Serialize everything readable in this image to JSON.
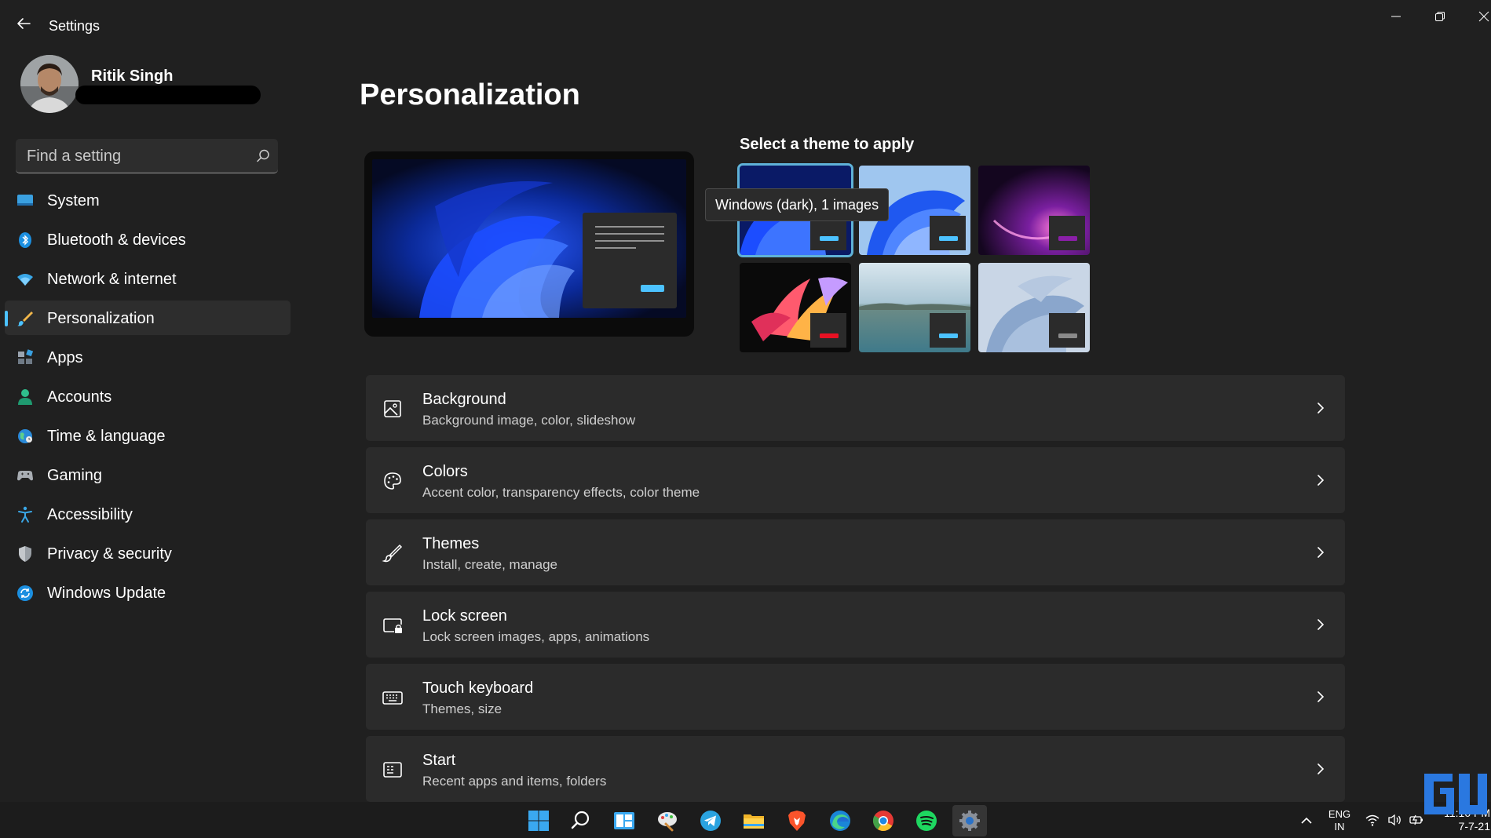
{
  "window": {
    "title": "Settings"
  },
  "profile": {
    "name": "Ritik Singh"
  },
  "search": {
    "placeholder": "Find a setting"
  },
  "sidebar": {
    "items": [
      {
        "label": "System",
        "icon": "system-icon",
        "active": false
      },
      {
        "label": "Bluetooth & devices",
        "icon": "bluetooth-icon",
        "active": false
      },
      {
        "label": "Network & internet",
        "icon": "wifi-icon",
        "active": false
      },
      {
        "label": "Personalization",
        "icon": "brush-icon",
        "active": true
      },
      {
        "label": "Apps",
        "icon": "apps-icon",
        "active": false
      },
      {
        "label": "Accounts",
        "icon": "accounts-icon",
        "active": false
      },
      {
        "label": "Time & language",
        "icon": "globe-icon",
        "active": false
      },
      {
        "label": "Gaming",
        "icon": "gamepad-icon",
        "active": false
      },
      {
        "label": "Accessibility",
        "icon": "accessibility-icon",
        "active": false
      },
      {
        "label": "Privacy & security",
        "icon": "shield-icon",
        "active": false
      },
      {
        "label": "Windows Update",
        "icon": "update-icon",
        "active": false
      }
    ]
  },
  "main": {
    "title": "Personalization",
    "theme_heading": "Select a theme to apply",
    "tooltip": "Windows (dark), 1 images",
    "themes": [
      {
        "name": "windows-dark-theme",
        "selected": true,
        "accent": "#4cc2ff"
      },
      {
        "name": "windows-light-theme",
        "selected": false,
        "accent": "#4cc2ff"
      },
      {
        "name": "glow-theme",
        "selected": false,
        "accent": "#8a1fa8"
      },
      {
        "name": "captured-motion-theme",
        "selected": false,
        "accent": "#e81123"
      },
      {
        "name": "sunrise-theme",
        "selected": false,
        "accent": "#4cc2ff"
      },
      {
        "name": "flow-theme",
        "selected": false,
        "accent": "#8a8a8a"
      }
    ],
    "cards": [
      {
        "title": "Background",
        "subtitle": "Background image, color, slideshow",
        "icon": "picture-icon"
      },
      {
        "title": "Colors",
        "subtitle": "Accent color, transparency effects, color theme",
        "icon": "palette-icon"
      },
      {
        "title": "Themes",
        "subtitle": "Install, create, manage",
        "icon": "brush-icon"
      },
      {
        "title": "Lock screen",
        "subtitle": "Lock screen images, apps, animations",
        "icon": "lock-screen-icon"
      },
      {
        "title": "Touch keyboard",
        "subtitle": "Themes, size",
        "icon": "keyboard-icon"
      },
      {
        "title": "Start",
        "subtitle": "Recent apps and items, folders",
        "icon": "start-menu-icon"
      }
    ]
  },
  "taskbar": {
    "apps": [
      "start-icon",
      "search-icon",
      "widgets-icon",
      "paint-icon",
      "telegram-icon",
      "file-explorer-icon",
      "brave-icon",
      "edge-icon",
      "chrome-icon",
      "spotify-icon",
      "settings-icon"
    ],
    "lang_line1": "ENG",
    "lang_line2": "IN",
    "time": "11:10 PM",
    "date": "7-7-21"
  },
  "colors": {
    "background": "#202020",
    "card": "#2b2b2b",
    "accent": "#4cc2ff"
  }
}
